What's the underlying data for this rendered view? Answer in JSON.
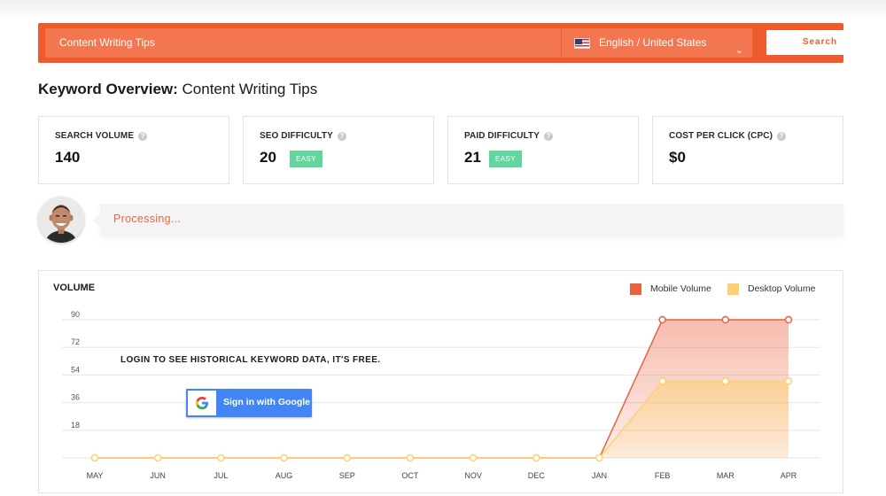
{
  "search": {
    "query": "Content Writing Tips",
    "language": "English / United States",
    "button_label": "Search"
  },
  "overview": {
    "title_bold": "Keyword Overview:",
    "title_keyword": "Content Writing Tips"
  },
  "metrics": [
    {
      "label": "SEARCH VOLUME",
      "value": "140",
      "badge": ""
    },
    {
      "label": "SEO DIFFICULTY",
      "value": "20",
      "badge": "EASY"
    },
    {
      "label": "PAID DIFFICULTY",
      "value": "21",
      "badge": "EASY"
    },
    {
      "label": "COST PER CLICK (CPC)",
      "value": "$0",
      "badge": ""
    }
  ],
  "help_glyph": "?",
  "processing": {
    "text": "Processing..."
  },
  "volume": {
    "title": "VOLUME",
    "login_prompt": "LOGIN TO SEE HISTORICAL KEYWORD DATA, IT'S FREE.",
    "google_button": "Sign in with Google"
  },
  "colors": {
    "brand": "#ef5b2d",
    "mobile": "#e9623f",
    "desktop": "#ffd071",
    "easy_badge": "#60d59c",
    "google": "#4285f4"
  },
  "chart_data": {
    "type": "area",
    "categories": [
      "MAY",
      "JUN",
      "JUL",
      "AUG",
      "SEP",
      "OCT",
      "NOV",
      "DEC",
      "JAN",
      "FEB",
      "MAR",
      "APR"
    ],
    "yticks": [
      18,
      36,
      54,
      72,
      90
    ],
    "ylim": [
      0,
      90
    ],
    "grid": true,
    "legend_position": "top-right",
    "series": [
      {
        "name": "Mobile Volume",
        "values": [
          0,
          0,
          0,
          0,
          0,
          0,
          0,
          0,
          0,
          90,
          90,
          90
        ]
      },
      {
        "name": "Desktop Volume",
        "values": [
          0,
          0,
          0,
          0,
          0,
          0,
          0,
          0,
          0,
          50,
          50,
          50
        ]
      }
    ]
  }
}
